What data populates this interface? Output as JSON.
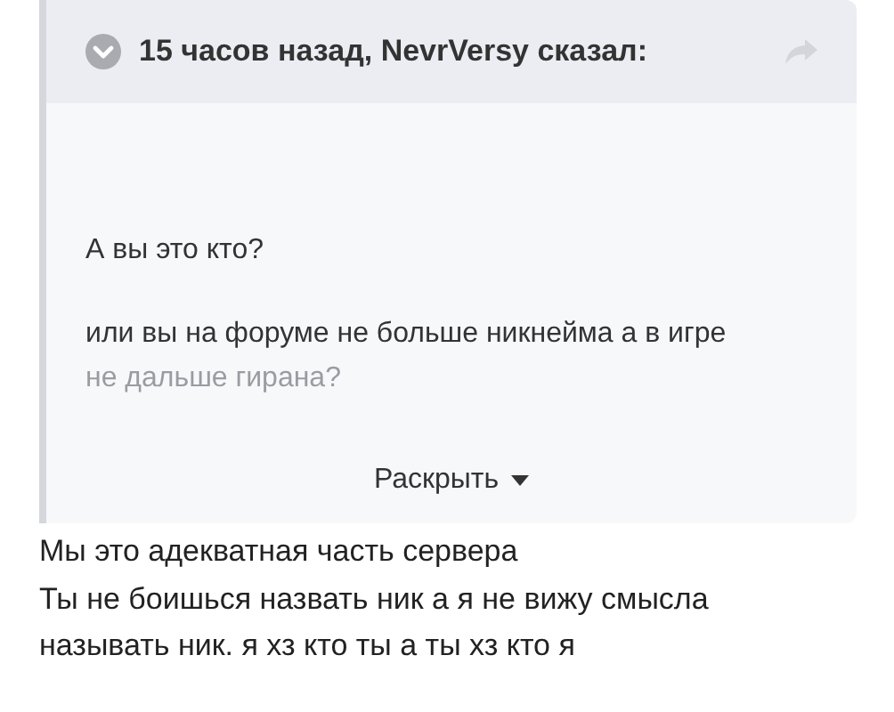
{
  "quote": {
    "expanded": false,
    "header": "15 часов назад, NevrVersy сказал:",
    "paragraphs": [
      {
        "lines": [
          {
            "text": "А вы это кто?",
            "faded": false
          }
        ]
      },
      {
        "lines": [
          {
            "text": "или вы на форуме не больше никнейма а в игре",
            "faded": false
          },
          {
            "text": "не дальше гирана?",
            "faded": true
          }
        ]
      }
    ],
    "expand_label": "Раскрыть"
  },
  "reply": {
    "lines": [
      "Мы это адекватная часть сервера",
      "Ты не боишься назвать ник а я не вижу смысла",
      "называть ник. я хз кто ты а ты хз кто я"
    ]
  }
}
